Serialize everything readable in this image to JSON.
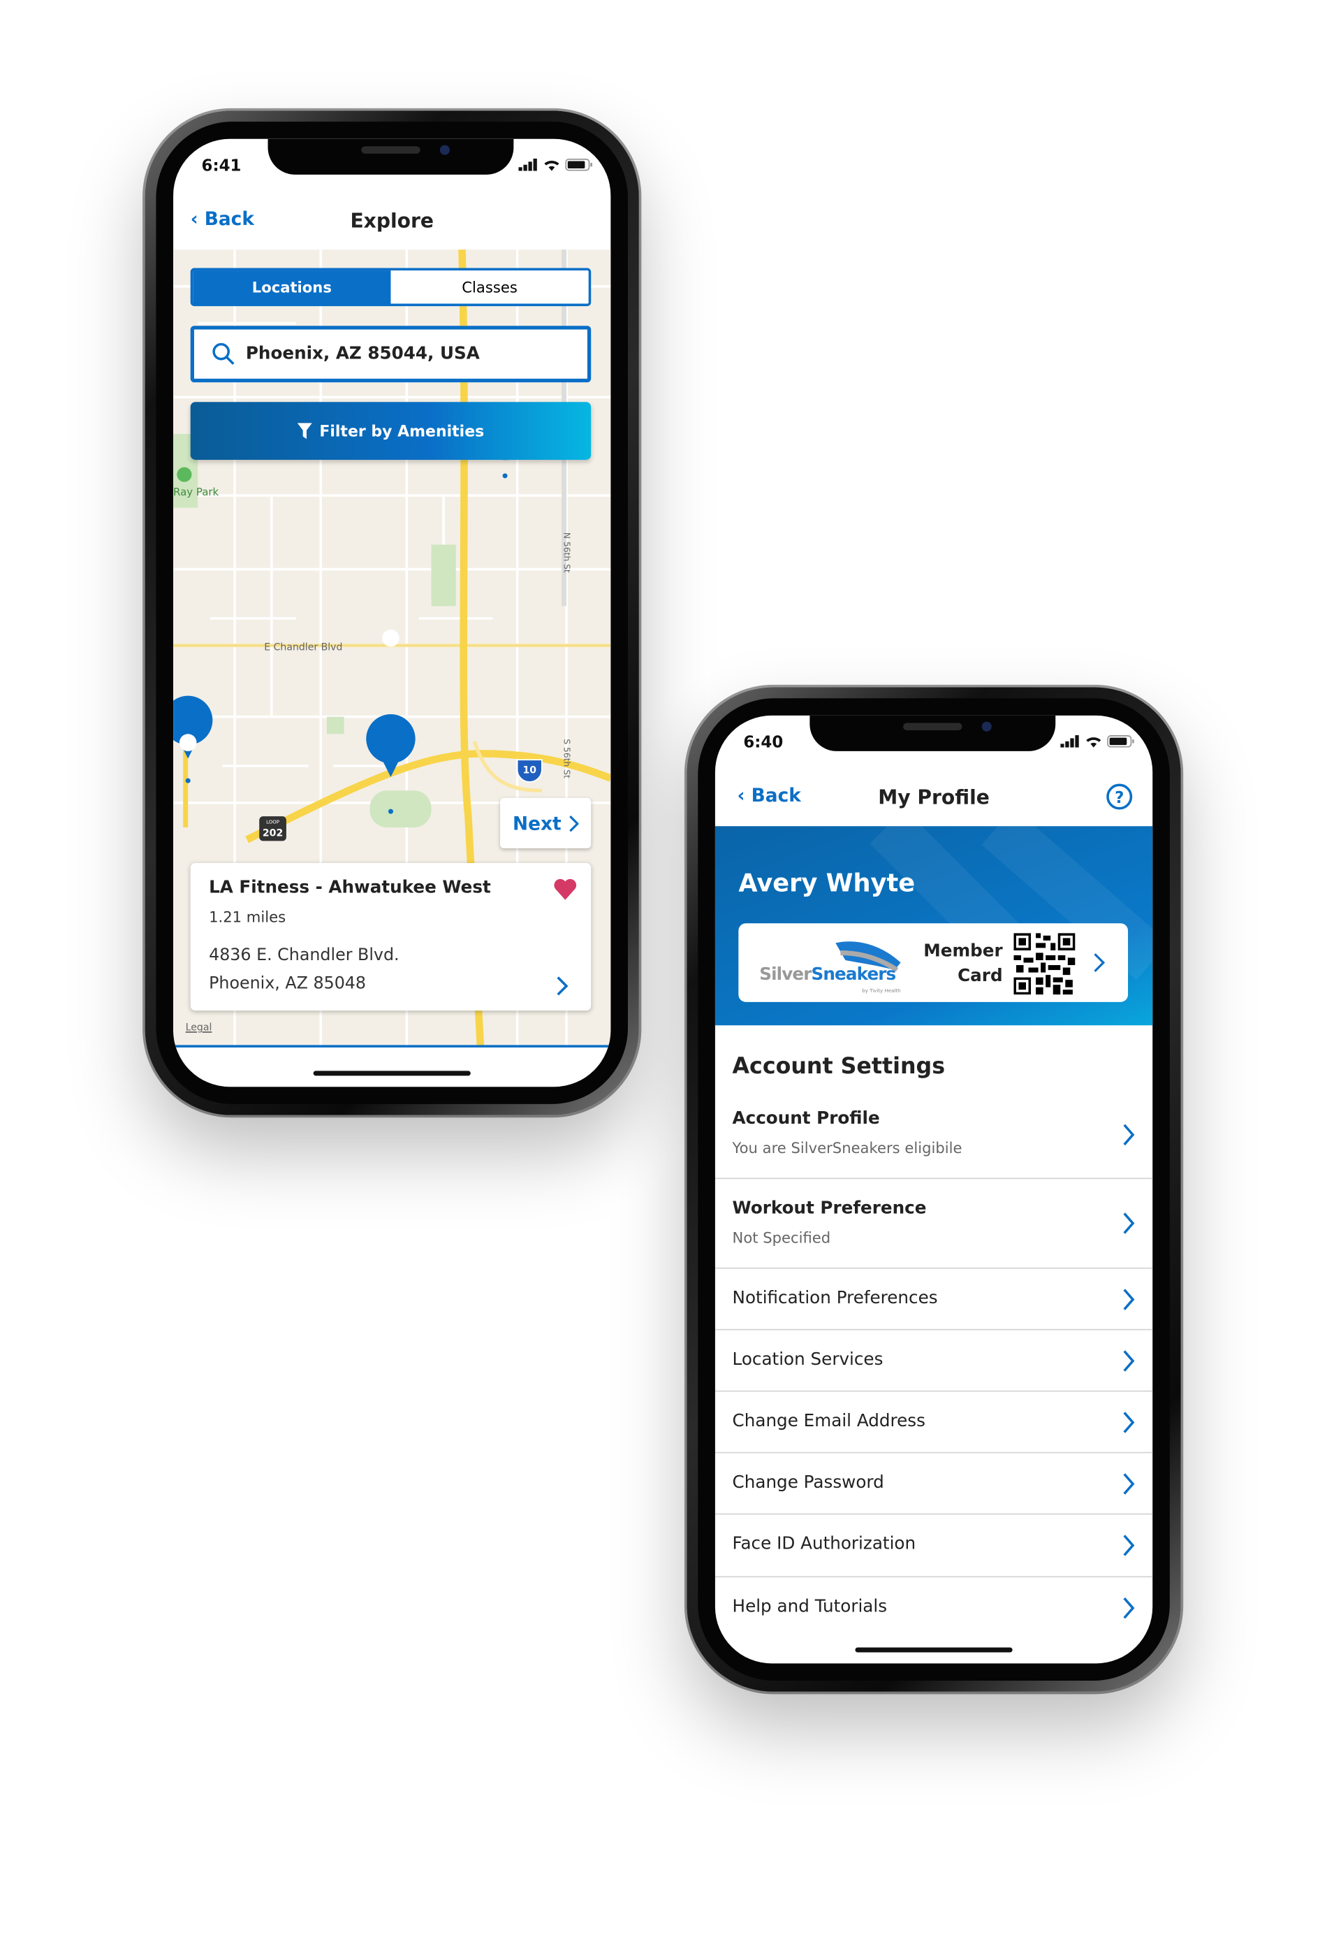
{
  "explore_phone": {
    "status": {
      "time": "6:41"
    },
    "nav": {
      "back": "Back",
      "title": "Explore"
    },
    "tabs": [
      {
        "label": "Locations",
        "selected": true
      },
      {
        "label": "Classes",
        "selected": false
      }
    ],
    "search": {
      "value": "Phoenix, AZ 85044, USA",
      "icon": "search-icon"
    },
    "filter_button": "Filter by Amenities",
    "map_labels": {
      "park": "Ray Park",
      "street1": "E Chandler Blvd",
      "street2": "N 56th St",
      "street3": "S 56th St",
      "loop_shield": "202",
      "loop_word": "LOOP",
      "interstate": "10"
    },
    "next_button": "Next",
    "location_card": {
      "name": "LA Fitness - Ahwatukee West",
      "distance": "1.21 miles",
      "address1": "4836 E. Chandler Blvd.",
      "address2": "Phoenix, AZ 85048",
      "favorited": true
    },
    "legal": "Legal"
  },
  "profile_phone": {
    "status": {
      "time": "6:40"
    },
    "nav": {
      "back": "Back",
      "title": "My Profile",
      "help_icon": "question-circle-icon"
    },
    "user_name": "Avery Whyte",
    "member_card": {
      "logo_silver": "Silver",
      "logo_sneakers": "Sneakers",
      "logo_sub": "by Tivity Health",
      "label_line1": "Member",
      "label_line2": "Card"
    },
    "section_title": "Account Settings",
    "items": [
      {
        "title": "Account Profile",
        "subtitle": "You are SilverSneakers eligibile"
      },
      {
        "title": "Workout Preference",
        "subtitle": "Not Specified"
      },
      {
        "title": "Notification Preferences"
      },
      {
        "title": "Location Services"
      },
      {
        "title": "Change Email Address"
      },
      {
        "title": "Change Password"
      },
      {
        "title": "Face ID Authorization"
      },
      {
        "title": "Help and Tutorials"
      }
    ]
  },
  "colors": {
    "brand_blue": "#0a6fc7",
    "heart": "#d43a65",
    "map_bg": "#f3efe6",
    "highway": "#f8d44a"
  }
}
